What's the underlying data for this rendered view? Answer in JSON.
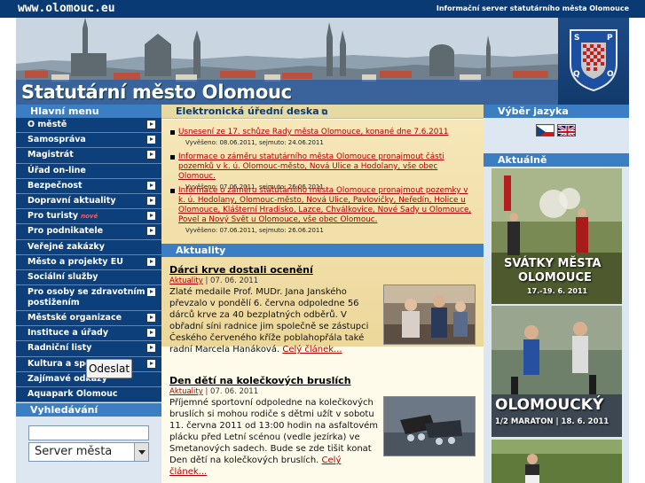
{
  "topbar": {
    "url": "www.olomouc.eu",
    "subtitle": "Informační server statutárního města Olomouce"
  },
  "header": {
    "title_light": "Statutární město",
    "title_strong": "Olomouc",
    "crest_letters": [
      "S",
      "P",
      "Q",
      "O"
    ]
  },
  "left": {
    "menu_title": "Hlavní menu",
    "menu": [
      {
        "label": "O městě",
        "arrow": true
      },
      {
        "label": "Samospráva",
        "arrow": true
      },
      {
        "label": "Magistrát",
        "arrow": true
      },
      {
        "label": "Úřad on-line",
        "arrow": false
      },
      {
        "label": "Bezpečnost",
        "arrow": true
      },
      {
        "label": "Dopravní aktuality",
        "arrow": true
      },
      {
        "label": "Pro turisty",
        "arrow": true,
        "badge": "nové"
      },
      {
        "label": "Pro podnikatele",
        "arrow": true
      },
      {
        "label": "Veřejné zakázky",
        "arrow": false
      },
      {
        "label": "Město a projekty EU",
        "arrow": true
      },
      {
        "label": "Sociální služby",
        "arrow": false
      },
      {
        "label": "Pro osoby se zdravotním postižením",
        "arrow": true,
        "tall": true
      },
      {
        "label": "Městské organizace",
        "arrow": true
      },
      {
        "label": "Instituce a úřady",
        "arrow": true
      },
      {
        "label": "Radniční listy",
        "arrow": true
      },
      {
        "label": "Kultura a sport",
        "arrow": true
      },
      {
        "label": "Zajímavé odkazy",
        "arrow": false
      },
      {
        "label": "Aquapark Olomouc",
        "arrow": false
      }
    ],
    "search_title": "Vyhledávání",
    "search_value": "",
    "search_scope": "Server města",
    "search_button": "Odeslat"
  },
  "center": {
    "notice_title": "Elektronická úřední deska",
    "notice_ext_icon": "external-link-icon",
    "notices": [
      {
        "text": "Usnesení ze 17. schůze Rady města Olomouce, konané dne 7.6.2011",
        "meta": "Vyvěšeno: 08.06.2011, sejmuto: 24.06.2011"
      },
      {
        "text": "Informace o záměru statutárního města Olomouce pronajmout části pozemků v k. ú. Olomouc-město, Nová Ulice a Hodolany, vše obec Olomouc.",
        "meta": "Vyvěšeno: 07.06.2011, sejmuto: 26.06.2011"
      },
      {
        "text": "Informace o záměru statutárního města Olomouce pronajmout pozemky v k. ú. Hodolany, Olomouc-město, Nová Ulice, Pavlovičky, Neředín, Holice u Olomouce, Klášterní Hradisko, Lazce, Chválkovice, Nové Sady u Olomouce, Povel a Nový Svět u Olomouce, vše obec Olomouc.",
        "meta": "Vyvěšeno: 07.06.2011, sejmuto: 26.06.2011"
      }
    ],
    "news_title": "Aktuality",
    "articles": [
      {
        "title": "Dárci krve dostali ocenění",
        "category": "Aktuality",
        "date": "07. 06. 2011",
        "text": "Zlaté medaile Prof. MUDr. Jana Janského převzalo v pondělí 6. června odpoledne 56 dárců krve za 40 bezplatných odběrů. V obřadní síni radnice jim společně se zástupci Českého červeného kříže poblahopřála také radní Marcela Hanáková.",
        "more": "Celý článek..."
      },
      {
        "title": "Den dětí na kolečkových bruslích",
        "category": "Aktuality",
        "date": "07. 06. 2011",
        "text": "Příjemné sportovní odpoledne na kolečkových bruslích si mohou rodiče s dětmi užít v sobotu 11. června 2011 od 13:00 hodin na asfaltovém plácku před Letní scénou (vedle jezírka) ve Smetanových sadech. Bude se zde tišit konat Den dětí na kolečkových bruslích.",
        "more": "Celý článek..."
      }
    ]
  },
  "right": {
    "lang_title": "Výběr jazyka",
    "languages": [
      "Čeština",
      "English"
    ],
    "news_title": "Aktuálně",
    "promo1_line1": "SVÁTKY MĚSTA",
    "promo1_line2": "OLOMOUCE",
    "promo1_dates": "17.-19. 6. 2011",
    "promo2_line1": "OLOMOUCKÝ",
    "promo2_line2": "1/2 MARATON | 18. 6. 2011"
  },
  "colors": {
    "navy": "#0d3f7a",
    "accent_blue": "#3b7ec4",
    "link_red": "#b10000",
    "notice_bg": "#f1dea7"
  }
}
